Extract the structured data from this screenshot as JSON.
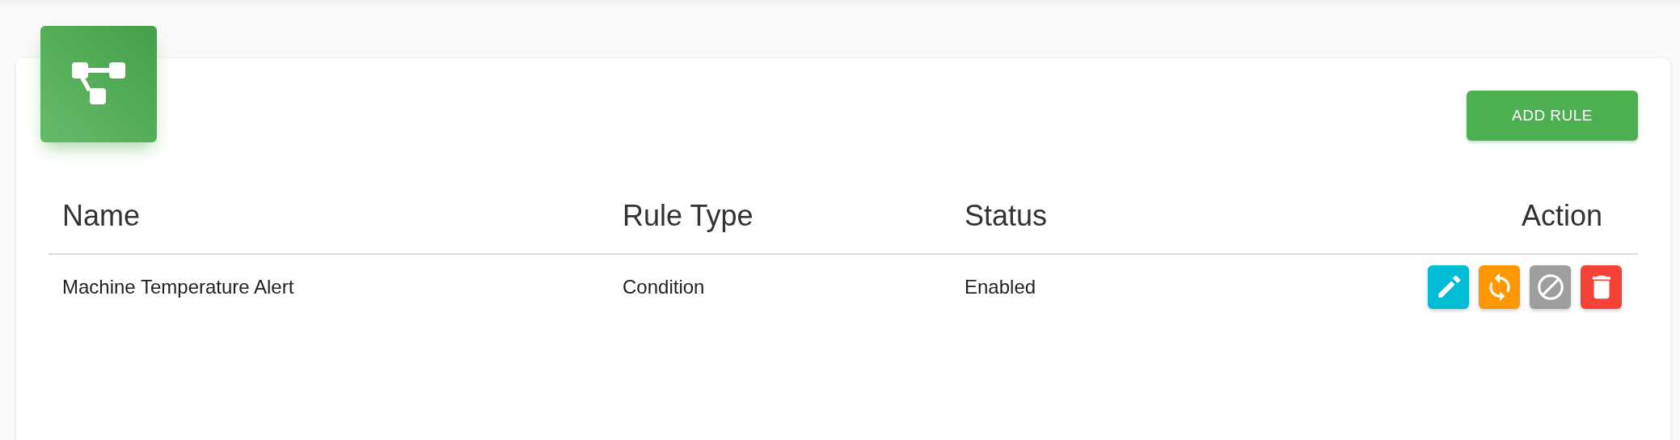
{
  "add_button": {
    "label": "ADD RULE"
  },
  "table": {
    "columns": [
      "Name",
      "Rule Type",
      "Status",
      "Action"
    ],
    "rows": [
      {
        "name": "Machine Temperature Alert",
        "rule_type": "Condition",
        "status": "Enabled",
        "actions": [
          {
            "kind": "edit",
            "color": "#00bcd4"
          },
          {
            "kind": "sync",
            "color": "#ff9800"
          },
          {
            "kind": "disable",
            "color": "#9e9e9e"
          },
          {
            "kind": "delete",
            "color": "#f44336"
          }
        ]
      }
    ]
  }
}
